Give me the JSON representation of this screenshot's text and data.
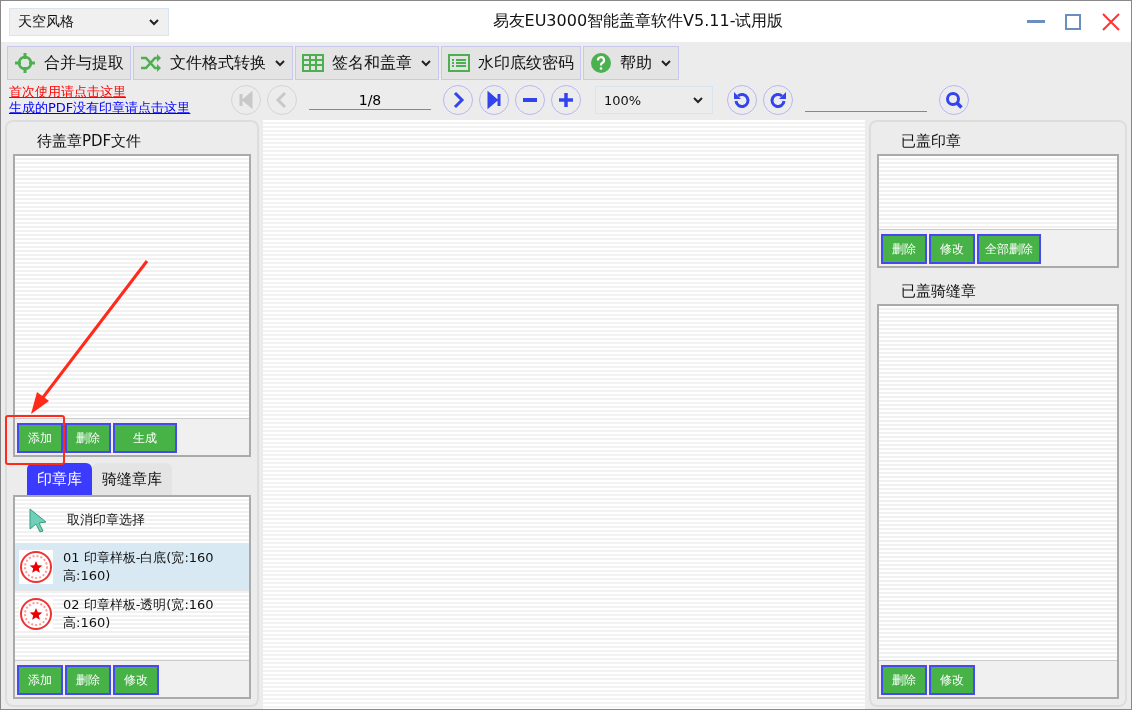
{
  "window": {
    "theme_select": "天空风格",
    "title": "易友EU3000智能盖章软件V5.11-试用版"
  },
  "toolbar": [
    {
      "kind": "merge",
      "label": "合并与提取",
      "dropdown": false
    },
    {
      "kind": "shuffle",
      "label": "文件格式转换",
      "dropdown": true
    },
    {
      "kind": "grid",
      "label": "签名和盖章",
      "dropdown": true
    },
    {
      "kind": "list",
      "label": "水印底纹密码",
      "dropdown": false
    },
    {
      "kind": "help",
      "label": "帮助",
      "dropdown": true
    }
  ],
  "links": [
    {
      "label": "首次使用请点击这里",
      "color": "#ff0000"
    },
    {
      "label": "生成的PDF没有印章请点击这里",
      "color": "#0000ff"
    }
  ],
  "navigation": {
    "buttons": [
      {
        "kind": "first",
        "disabled": true
      },
      {
        "kind": "prev",
        "disabled": true
      }
    ],
    "page": "1/8",
    "buttons2": [
      {
        "kind": "next",
        "disabled": false
      },
      {
        "kind": "last",
        "disabled": false
      },
      {
        "kind": "zoom-out",
        "disabled": false
      },
      {
        "kind": "zoom-in",
        "disabled": false
      }
    ],
    "zoom": "100%",
    "buttons3": [
      {
        "kind": "rotate-left",
        "disabled": false
      },
      {
        "kind": "rotate-right",
        "disabled": false
      }
    ]
  },
  "pending_files": {
    "title": "待盖章PDF文件",
    "buttons": [
      "添加",
      "删除",
      "生成"
    ]
  },
  "stamp_tabs": [
    {
      "label": "印章库",
      "selected": true
    },
    {
      "label": "骑缝章库",
      "selected": false
    }
  ],
  "stamps": [
    {
      "kind": "cancel",
      "label": "取消印章选择",
      "selected": false
    },
    {
      "kind": "stamp",
      "label": "01 印章样板-白底(宽:160 高:160)",
      "selected": true
    },
    {
      "kind": "stamp",
      "label": "02 印章样板-透明(宽:160 高:160)",
      "selected": false
    }
  ],
  "stamp_buttons": [
    "添加",
    "删除",
    "修改"
  ],
  "applied_stamps": {
    "title": "已盖印章",
    "buttons": [
      "删除",
      "修改",
      "全部删除"
    ]
  },
  "applied_seam_stamps": {
    "title": "已盖骑缝章",
    "buttons": [
      "删除",
      "修改"
    ]
  }
}
